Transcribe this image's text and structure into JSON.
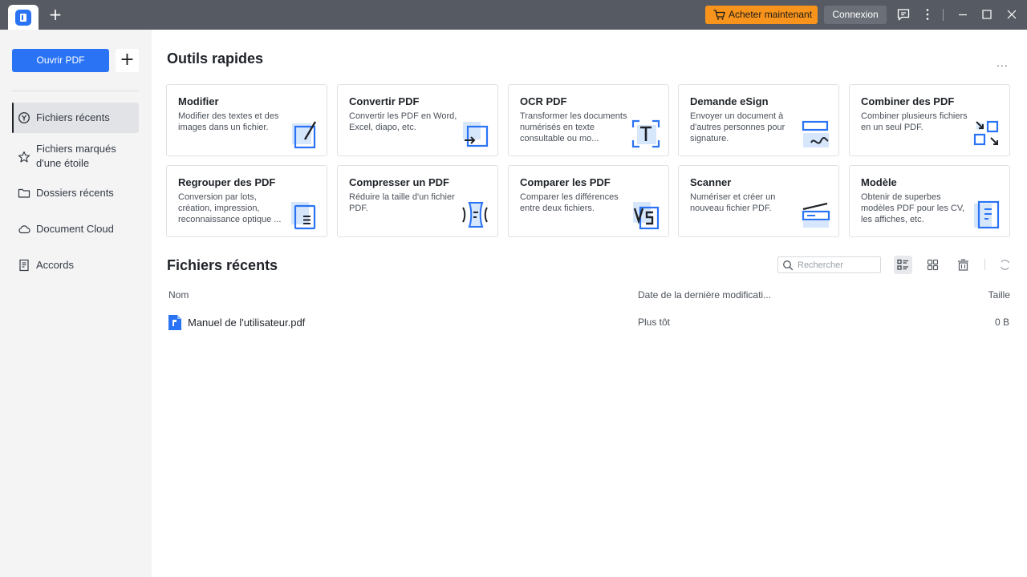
{
  "titlebar": {
    "new_tab_symbol": "+",
    "buy_label": "Acheter maintenant",
    "login_label": "Connexion",
    "icons": [
      "cart-icon",
      "feedback-icon",
      "more-vertical-icon",
      "minimize-icon",
      "maximize-icon",
      "close-icon"
    ]
  },
  "sidebar": {
    "open_label": "Ouvrir PDF",
    "plus_symbol": "+",
    "items": [
      {
        "label": "Fichiers récents",
        "icon": "clock-icon",
        "active": true
      },
      {
        "label": "Fichiers marqués d'une étoile",
        "icon": "star-icon",
        "active": false
      },
      {
        "label": "Dossiers récents",
        "icon": "folder-icon",
        "active": false
      },
      {
        "label": "Document Cloud",
        "icon": "cloud-icon",
        "active": false
      },
      {
        "label": "Accords",
        "icon": "document-icon",
        "active": false
      }
    ]
  },
  "quick_tools": {
    "title": "Outils rapides",
    "more": "...",
    "cards": [
      {
        "title": "Modifier",
        "desc": "Modifier des textes et des images dans un fichier.",
        "icon": "edit-icon"
      },
      {
        "title": "Convertir PDF",
        "desc": "Convertir les PDF en Word, Excel, diapo, etc.",
        "icon": "convert-icon"
      },
      {
        "title": "OCR PDF",
        "desc": "Transformer les documents numérisés en texte consultable ou mo...",
        "icon": "ocr-icon"
      },
      {
        "title": "Demande eSign",
        "desc": "Envoyer un document à d'autres personnes pour signature.",
        "icon": "esign-icon"
      },
      {
        "title": "Combiner des PDF",
        "desc": "Combiner plusieurs fichiers en un seul PDF.",
        "icon": "combine-icon"
      },
      {
        "title": "Regrouper des PDF",
        "desc": "Conversion par lots, création, impression, reconnaissance optique ...",
        "icon": "batch-icon"
      },
      {
        "title": "Compresser un PDF",
        "desc": "Réduire la taille d'un fichier PDF.",
        "icon": "compress-icon"
      },
      {
        "title": "Comparer les PDF",
        "desc": "Comparer les différences entre deux fichiers.",
        "icon": "compare-icon"
      },
      {
        "title": "Scanner",
        "desc": "Numériser et créer un nouveau fichier PDF.",
        "icon": "scanner-icon"
      },
      {
        "title": "Modèle",
        "desc": "Obtenir de superbes modèles PDF pour les CV, les affiches, etc.",
        "icon": "template-icon"
      }
    ]
  },
  "recent": {
    "title": "Fichiers récents",
    "search_placeholder": "Rechercher",
    "columns": {
      "name": "Nom",
      "date": "Date de la dernière modificati...",
      "size": "Taille"
    },
    "files": [
      {
        "name": "Manuel de l'utilisateur.pdf",
        "date": "Plus tôt",
        "size": "0 B"
      }
    ]
  },
  "colors": {
    "accent": "#2a73f5",
    "buy": "#f8941c",
    "titlebar": "#565b63",
    "sidebar": "#f4f4f5"
  }
}
